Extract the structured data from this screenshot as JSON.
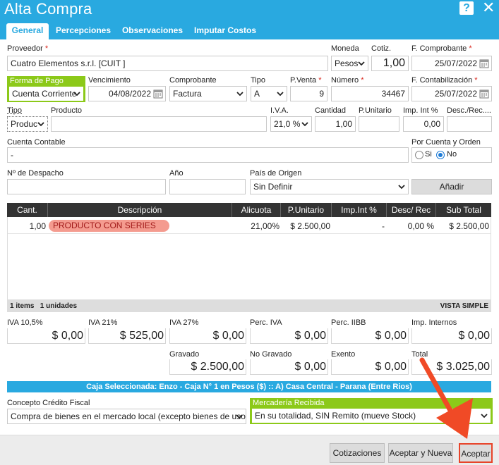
{
  "window": {
    "title": "Alta Compra"
  },
  "tabs": [
    "General",
    "Percepciones",
    "Observaciones",
    "Imputar Costos"
  ],
  "proveedor": {
    "label": "Proveedor",
    "value": "Cuatro Elementos s.r.l. [CUIT ]"
  },
  "moneda": {
    "label": "Moneda",
    "value": "Pesos"
  },
  "cotiz": {
    "label": "Cotiz.",
    "value": "1,00"
  },
  "f_comprobante": {
    "label": "F. Comprobante",
    "value": "25/07/2022"
  },
  "forma_pago": {
    "label": "Forma de Pago",
    "value": "Cuenta Corriente"
  },
  "vencimiento": {
    "label": "Vencimiento",
    "value": "04/08/2022"
  },
  "comprobante": {
    "label": "Comprobante",
    "value": "Factura"
  },
  "tipo_comp": {
    "label": "Tipo",
    "value": "A"
  },
  "pventa": {
    "label": "P.Venta",
    "value": "9"
  },
  "numero": {
    "label": "Número",
    "value": "34467"
  },
  "f_contab": {
    "label": "F. Contabilización",
    "value": "25/07/2022"
  },
  "tipo_prod": {
    "label": "Tipo",
    "value": "Produc"
  },
  "producto": {
    "label": "Producto",
    "value": ""
  },
  "iva": {
    "label": "I.V.A.",
    "value": "21,0 %"
  },
  "cantidad": {
    "label": "Cantidad",
    "value": "1,00"
  },
  "p_unitario": {
    "label": "P.Unitario",
    "value": ""
  },
  "imp_int": {
    "label": "Imp. Int %",
    "value": "0,00"
  },
  "desc_rec": {
    "label": "Desc./Rec....",
    "value": ""
  },
  "cuenta_contable": {
    "label": "Cuenta Contable",
    "value": "-"
  },
  "por_cuenta": {
    "label": "Por Cuenta y Orden",
    "si": "Si",
    "no": "No"
  },
  "despacho": {
    "label": "Nº de Despacho",
    "value": ""
  },
  "anio": {
    "label": "Año",
    "value": ""
  },
  "pais": {
    "label": "País de Origen",
    "value": "Sin Definir"
  },
  "anadir": "Añadir",
  "table": {
    "headers": [
      "Cant.",
      "Descripción",
      "Alicuota",
      "P.Unitario",
      "Imp.Int %",
      "Desc/ Rec",
      "Sub Total"
    ],
    "rows": [
      {
        "cant": "1,00",
        "desc": "PRODUCTO CON SERIES",
        "alicuota": "21,00%",
        "punit": "$ 2.500,00",
        "impint": "-",
        "desc_rec": "0,00 %",
        "subtotal": "$ 2.500,00"
      }
    ],
    "footer_items": "1 items   1 unidades",
    "footer_view": "VISTA SIMPLE"
  },
  "totals": {
    "iva105": {
      "label": "IVA 10,5%",
      "value": "$ 0,00"
    },
    "iva21": {
      "label": "IVA 21%",
      "value": "$ 525,00"
    },
    "iva27": {
      "label": "IVA 27%",
      "value": "$ 0,00"
    },
    "perc_iva": {
      "label": "Perc. IVA",
      "value": "$ 0,00"
    },
    "perc_iibb": {
      "label": "Perc. IIBB",
      "value": "$ 0,00"
    },
    "imp_int": {
      "label": "Imp. Internos",
      "value": "$ 0,00"
    },
    "gravado": {
      "label": "Gravado",
      "value": "$ 2.500,00"
    },
    "no_gravado": {
      "label": "No Gravado",
      "value": "$ 0,00"
    },
    "exento": {
      "label": "Exento",
      "value": "$ 0,00"
    },
    "total": {
      "label": "Total",
      "value": "$ 3.025,00"
    }
  },
  "caja": "Caja Seleccionada: Enzo - Caja N° 1 en Pesos ($) :: A) Casa Central - Parana (Entre Rios)",
  "concepto": {
    "label": "Concepto Crédito Fiscal",
    "value": "Compra de bienes en el mercado local (excepto bienes de uso)"
  },
  "mercaderia": {
    "label": "Mercadería Recibida",
    "value": "En su totalidad, SIN Remito (mueve Stock)"
  },
  "buttons": {
    "cotizaciones": "Cotizaciones",
    "aceptar_nueva": "Aceptar y Nueva",
    "aceptar": "Aceptar"
  }
}
